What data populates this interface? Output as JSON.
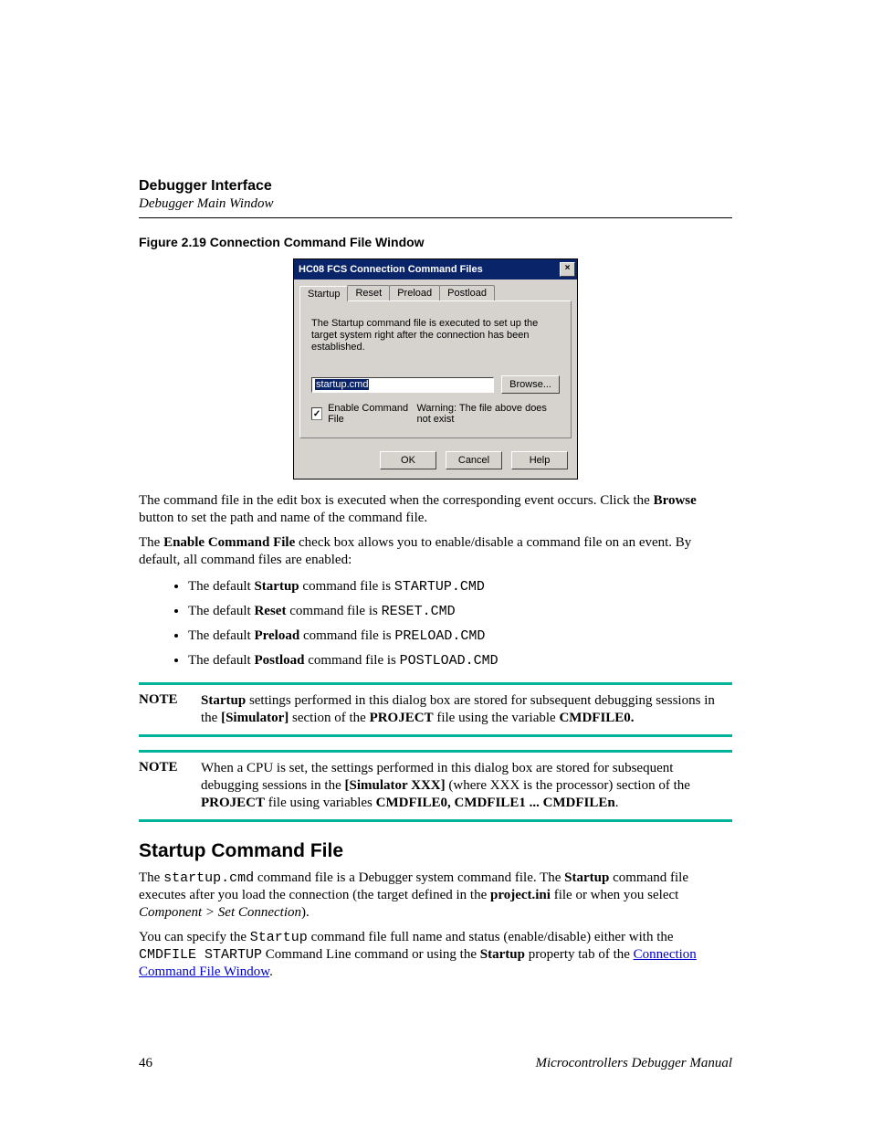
{
  "header": {
    "title": "Debugger Interface",
    "subtitle": "Debugger Main Window"
  },
  "figure": {
    "caption": "Figure 2.19  Connection Command File Window"
  },
  "dialog": {
    "title": "HC08 FCS Connection Command Files",
    "close_glyph": "×",
    "tabs": [
      "Startup",
      "Reset",
      "Preload",
      "Postload"
    ],
    "description": "The Startup command file is executed to set up the target system right after the connection has been established.",
    "file_value": "startup.cmd",
    "browse": "Browse...",
    "enable_label": "Enable Command File",
    "enable_check": "✓",
    "warning": "Warning: The file above does not exist",
    "buttons": {
      "ok": "OK",
      "cancel": "Cancel",
      "help": "Help"
    }
  },
  "paras": {
    "p1a": "The command file in the edit box is executed when the corresponding event occurs. Click the ",
    "p1b": "Browse",
    "p1c": " button to set the path and name of the command file.",
    "p2a": "The ",
    "p2b": "Enable Command File",
    "p2c": " check box allows you to enable/disable a command file on an event. By default, all command files are enabled:"
  },
  "bullets": [
    {
      "a": "The default ",
      "b": "Startup",
      "c": " command file is ",
      "code": "STARTUP.CMD"
    },
    {
      "a": "The default ",
      "b": "Reset",
      "c": " command file is ",
      "code": "RESET.CMD"
    },
    {
      "a": "The default ",
      "b": "Preload",
      "c": " command file is ",
      "code": "PRELOAD.CMD"
    },
    {
      "a": "The default ",
      "b": "Postload",
      "c": " command file is ",
      "code": "POSTLOAD.CMD"
    }
  ],
  "note1": {
    "label": "NOTE",
    "t1": "Startup",
    "t2": " settings performed in this dialog box are stored for subsequent debugging sessions in the ",
    "t3": "[Simulator]",
    "t4": " section of the ",
    "t5": "PROJECT",
    "t6": " file using the variable ",
    "t7": "CMDFILE0."
  },
  "note2": {
    "label": "NOTE",
    "t1": "When a CPU is set, the settings performed in this dialog box are stored for subsequent debugging sessions in the ",
    "t2": "[Simulator XXX]",
    "t3": " (where XXX is the processor) section of the ",
    "t4": "PROJECT",
    "t5": " file using variables ",
    "t6": "CMDFILE0, CMDFILE1 ... CMDFILEn",
    "t7": "."
  },
  "section_heading": "Startup Command File",
  "p3": {
    "a": "The ",
    "code1": "startup.cmd",
    "b": " command file is a Debugger system command file. The ",
    "bold1": "Startup",
    "c": " command file executes after you load the connection (the target defined in the ",
    "bold2": "project.ini",
    "d": " file or when you select ",
    "ital": "Component > Set Connection",
    "e": ")."
  },
  "p4": {
    "a": "You can specify the ",
    "code1": "Startup",
    "b": " command file full name and status (enable/disable) either with the ",
    "code2": "CMDFILE STARTUP",
    "c": " Command Line command or using the ",
    "bold1": "Startup",
    "d": " property tab of the ",
    "link": "Connection Command File Window",
    "e": "."
  },
  "footer": {
    "page": "46",
    "doctitle": "Microcontrollers Debugger Manual"
  }
}
